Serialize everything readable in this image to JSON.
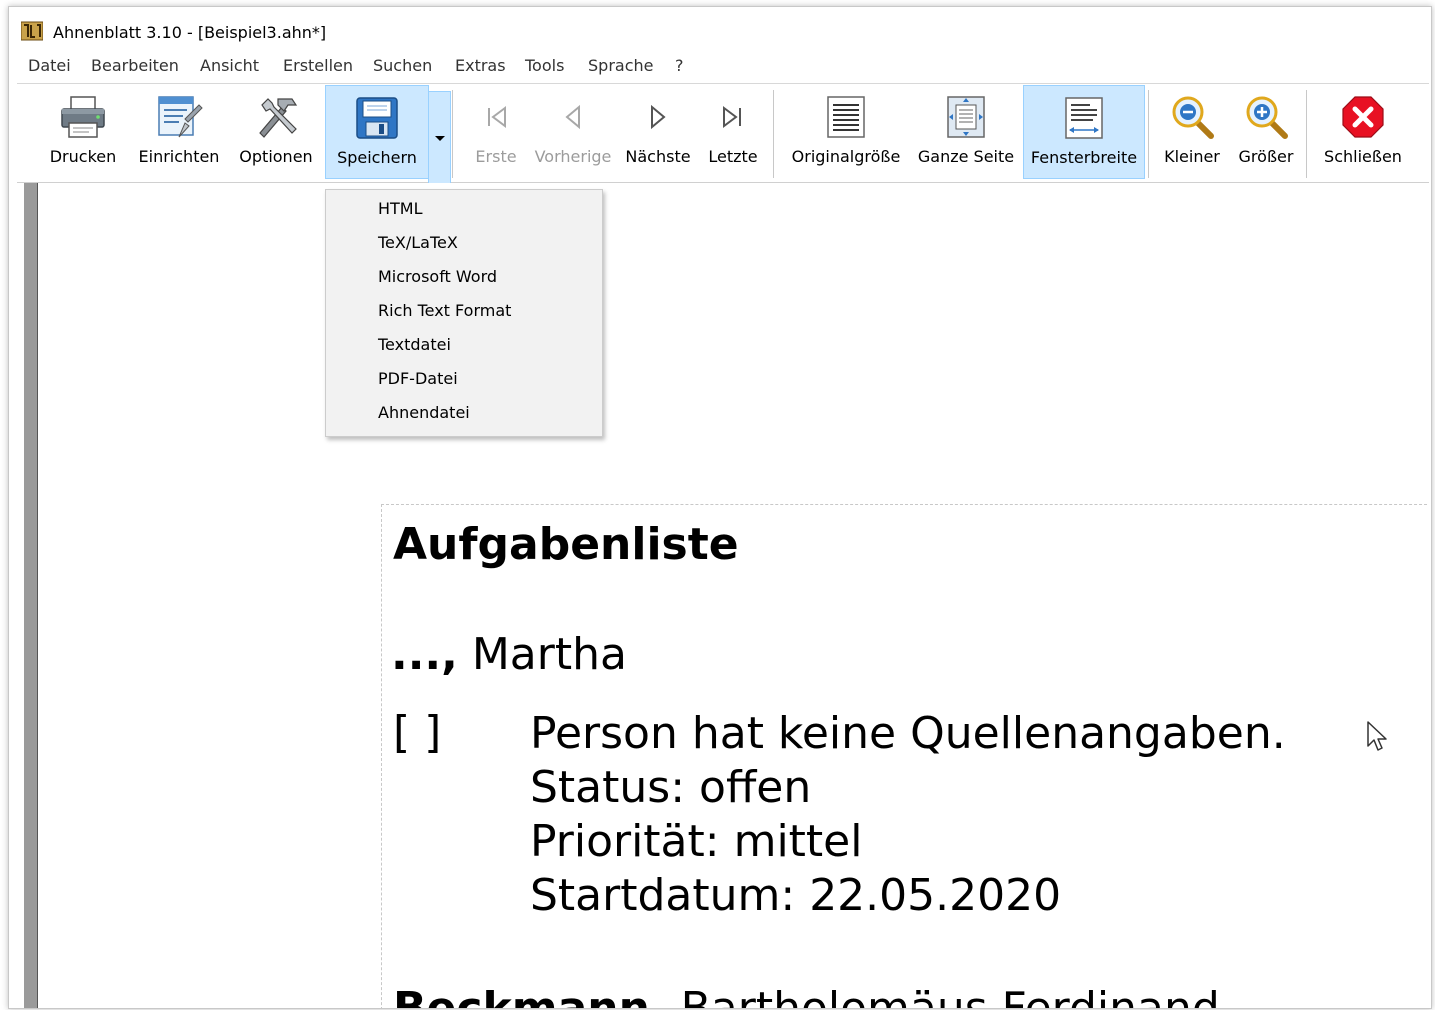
{
  "window": {
    "title": "Ahnenblatt 3.10 - [Beispiel3.ahn*]"
  },
  "menu": {
    "items": [
      "Datei",
      "Bearbeiten",
      "Ansicht",
      "Erstellen",
      "Suchen",
      "Extras",
      "Tools",
      "Sprache",
      "?"
    ]
  },
  "toolbar": {
    "drucken": "Drucken",
    "einrichten": "Einrichten",
    "optionen": "Optionen",
    "speichern": "Speichern",
    "erste": "Erste",
    "vorherige": "Vorherige",
    "naechste": "Nächste",
    "letzte": "Letzte",
    "originalgroesse": "Originalgröße",
    "ganze_seite": "Ganze Seite",
    "fensterbreite": "Fensterbreite",
    "kleiner": "Kleiner",
    "groesser": "Größer",
    "schliessen": "Schließen"
  },
  "save_menu": {
    "items": [
      "HTML",
      "TeX/LaTeX",
      "Microsoft Word",
      "Rich Text Format",
      "Textdatei",
      "PDF-Datei",
      "Ahnendatei"
    ]
  },
  "document": {
    "heading": "Aufgabenliste",
    "person1_surname": "...,",
    "person1_given": " Martha",
    "checkbox": "[ ]",
    "task_lines": [
      "Person hat keine Quellenangaben.",
      "Status: offen",
      "Priorität: mittel",
      "Startdatum: 22.05.2020"
    ],
    "person2_surname": "Beckmann,",
    "person2_given": " Bartholomäus Ferdinand"
  },
  "colors": {
    "active_bg": "#cce8ff",
    "active_border": "#99d1ff",
    "disabled_text": "#9c9c9c",
    "close_red": "#e81123"
  }
}
